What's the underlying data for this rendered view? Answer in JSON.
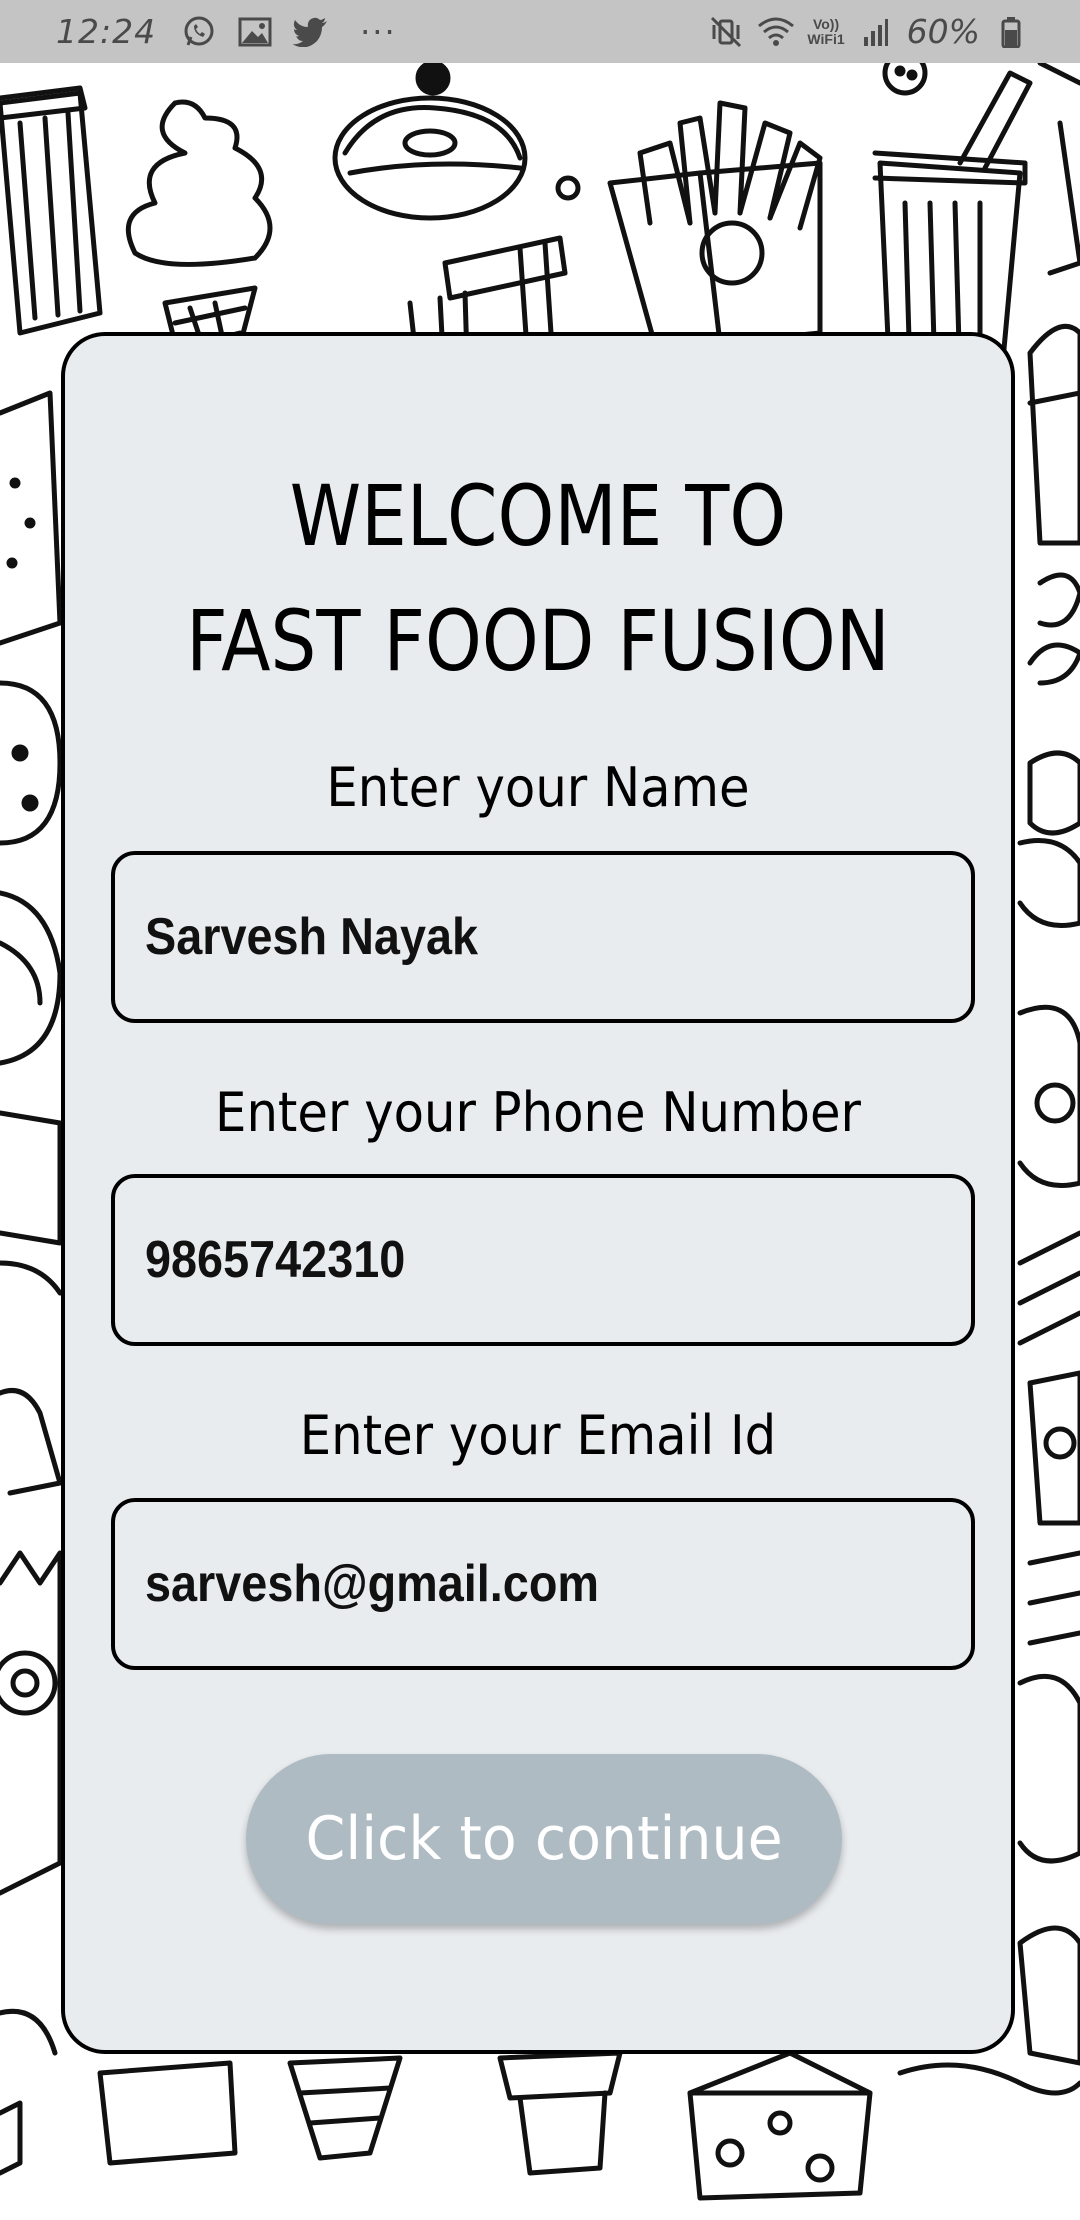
{
  "status_bar": {
    "time": "12:24",
    "icons_left": [
      "whatsapp-icon",
      "gallery-icon",
      "twitter-icon"
    ],
    "more": "···",
    "icons_right": [
      "mute-vibrate-icon",
      "wifi-icon",
      "signal-icon",
      "battery-icon"
    ],
    "volte_line1": "Vo))",
    "volte_line2": "WiFi1",
    "battery": "60%"
  },
  "card": {
    "title_line1": "WELCOME TO",
    "title_line2": "FAST FOOD FUSION",
    "name_label": "Enter your Name",
    "name_value": "Sarvesh Nayak",
    "phone_label": "Enter your Phone Number",
    "phone_value": "9865742310",
    "email_label": "Enter your Email Id",
    "email_value": "sarvesh@gmail.com",
    "continue_label": "Click to continue"
  },
  "colors": {
    "status_bar_bg": "#c4c4c4",
    "card_bg": "#e9ecef",
    "button_bg": "#aebbc3",
    "button_text": "#ffffff",
    "border": "#000000"
  }
}
